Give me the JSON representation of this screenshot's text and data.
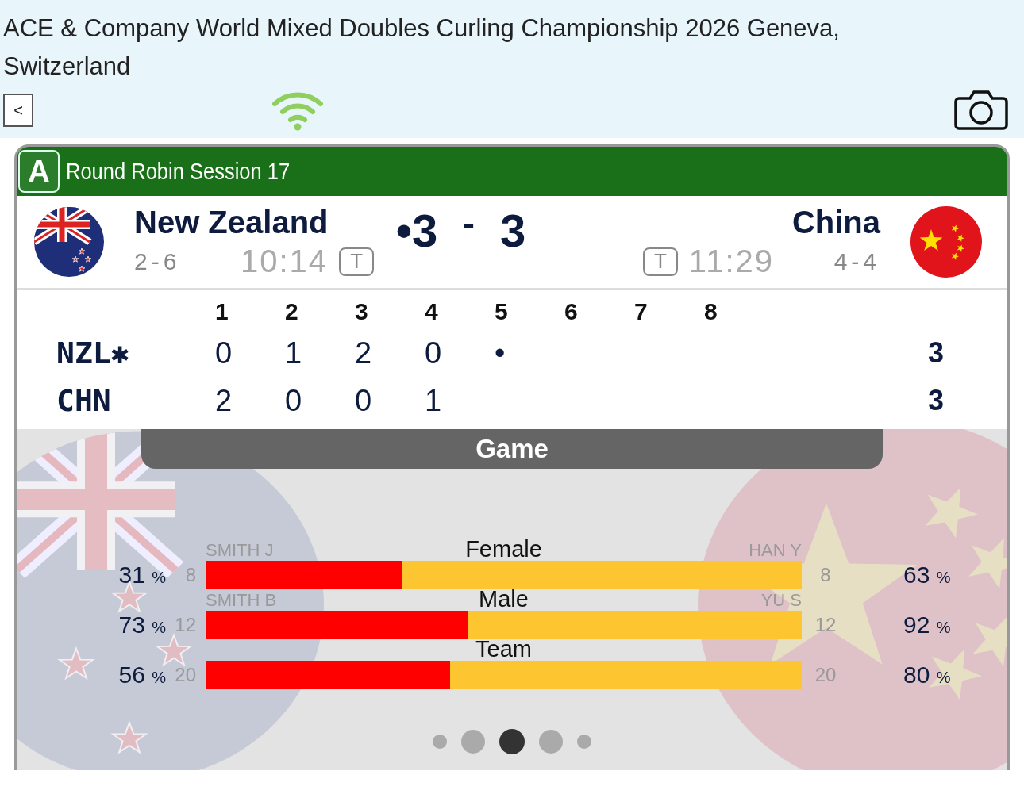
{
  "header": {
    "title": "ACE & Company World Mixed Doubles Curling Championship 2026 Geneva, Switzerland",
    "back_button": "<"
  },
  "game": {
    "sheet": "A",
    "session": "Round Robin Session 17",
    "score_separator": "-",
    "teams": [
      {
        "name": "New Zealand",
        "record": "2-6",
        "time": "10:14",
        "timeout": "T",
        "score": "•3"
      },
      {
        "name": "China",
        "record": "4-4",
        "time": "11:29",
        "timeout": "T",
        "score": "3"
      }
    ],
    "linescore": {
      "ends": [
        "1",
        "2",
        "3",
        "4",
        "5",
        "6",
        "7",
        "8"
      ],
      "rows": [
        {
          "team": "NZL✱",
          "ends": [
            "0",
            "1",
            "2",
            "0",
            "•"
          ],
          "total": "3"
        },
        {
          "team": "CHN",
          "ends": [
            "2",
            "0",
            "0",
            "1"
          ],
          "total": "3"
        }
      ]
    },
    "panel_title": "Game",
    "stats": [
      {
        "category": "Female",
        "left_name": "SMITH J",
        "right_name": "HAN Y",
        "left_pct": "31",
        "left_unit": "%",
        "left_count": "8",
        "right_count": "8",
        "right_pct": "63",
        "right_unit": "%",
        "level": 0.33
      },
      {
        "category": "Male",
        "left_name": "SMITH B",
        "right_name": "YU S",
        "left_pct": "73",
        "left_unit": "%",
        "left_count": "12",
        "right_count": "12",
        "right_pct": "92",
        "right_unit": "%",
        "level": 0.44
      },
      {
        "category": "Team",
        "left_pct": "56",
        "left_unit": "%",
        "left_count": "20",
        "right_count": "20",
        "right_pct": "80",
        "right_unit": "%",
        "level": 0.41
      }
    ],
    "pages": [
      {
        "selected": false
      },
      {
        "selected": false
      },
      {
        "selected": true
      },
      {
        "selected": false
      },
      {
        "selected": false
      }
    ]
  }
}
